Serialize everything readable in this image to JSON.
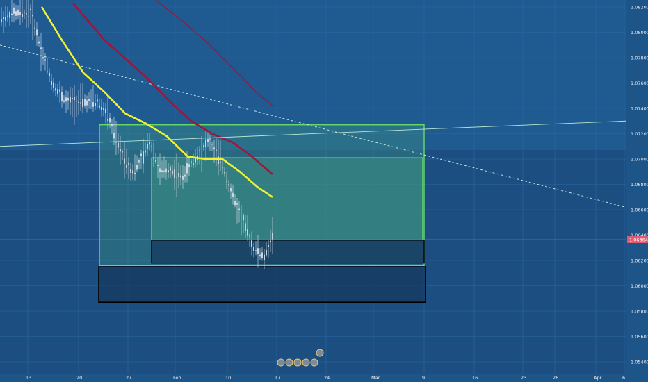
{
  "chart_data": {
    "type": "candlestick",
    "instrument_hint": "EURUSD",
    "y_axis": {
      "ticks": [
        "1.08200",
        "1.08000",
        "1.07800",
        "1.07600",
        "1.07400",
        "1.07200",
        "1.07000",
        "1.06800",
        "1.06600",
        "1.06400",
        "1.06200",
        "1.06000",
        "1.05800",
        "1.05600",
        "1.05400"
      ],
      "range": [
        1.0535,
        1.0826
      ]
    },
    "x_axis": {
      "ticks": [
        "13",
        "20",
        "27",
        "Feb",
        "10",
        "17",
        "24",
        "Mar",
        "9",
        "16",
        "23",
        "26",
        "Apr",
        "6"
      ]
    },
    "current_price": "1.06364",
    "current_price_value": 1.06364,
    "colors": {
      "background": "#1f5a91",
      "candles": "#c8d4e2",
      "ma_fast": "#f2f230",
      "ma_slow": "#a0153c",
      "ma_slower": "#a0153c",
      "zone_border": "#66dd66",
      "zone_fill": "#3f9a80",
      "demand_border": "#000000",
      "trendline": "#b8e6d2",
      "price_tag": "#e05a72"
    },
    "zones": [
      {
        "name": "outer-supply-zone",
        "top": 1.0727,
        "bottom": 1.0616
      },
      {
        "name": "inner-supply-zone",
        "top": 1.0701,
        "bottom": 1.0636
      },
      {
        "name": "upper-demand-box",
        "top": 1.0636,
        "bottom": 1.0618
      },
      {
        "name": "lower-demand-box",
        "top": 1.0615,
        "bottom": 1.0587
      }
    ],
    "grid": true,
    "legend": "none"
  },
  "events": {
    "icons": [
      "event-icon",
      "event-icon",
      "event-icon",
      "event-icon",
      "event-icon",
      "event-icon"
    ]
  }
}
